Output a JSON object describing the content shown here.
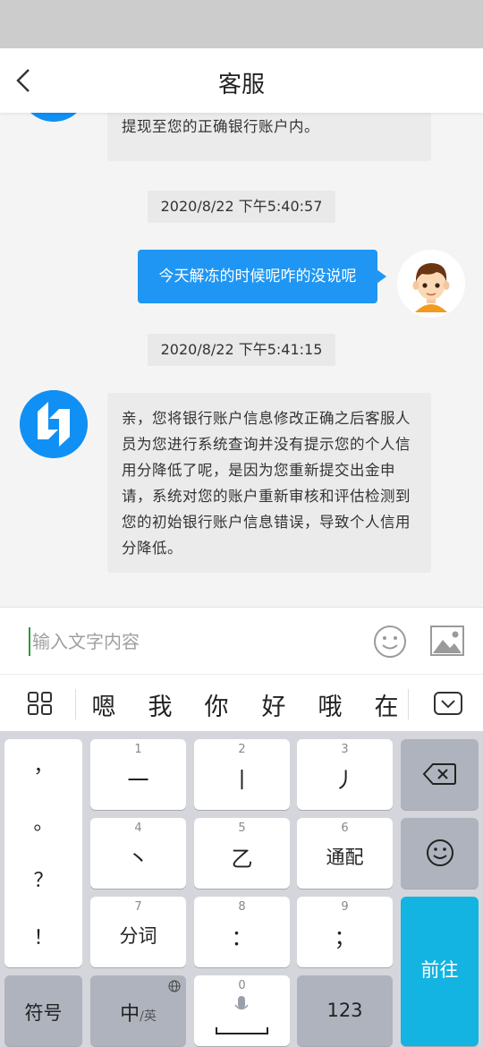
{
  "header": {
    "title": "客服",
    "back_icon": "chevron-left-icon"
  },
  "messages": {
    "agent_1_tail": "提现至您的正确银行账户内。",
    "timestamp_1": "2020/8/22 下午5:40:57",
    "user_1": "今天解冻的时候呢咋的没说呢",
    "timestamp_2": "2020/8/22 下午5:41:15",
    "agent_2": "亲，您将银行账户信息修改正确之后客服人员为您进行系统查询并没有提示您的个人信用分降低了呢，是因为您重新提交出金申请，系统对您的账户重新审核和评估检测到您的初始银行账户信息错误，导致个人信用分降低。"
  },
  "input": {
    "placeholder": "输入文字内容",
    "emoji_icon": "smiley-icon",
    "image_icon": "image-icon"
  },
  "candidates": {
    "menu_icon": "grid-icon",
    "items": [
      "嗯",
      "我",
      "你",
      "好",
      "哦",
      "在"
    ],
    "hide_icon": "keyboard-hide-icon"
  },
  "keyboard": {
    "punct": [
      "，",
      "。",
      "？",
      "！"
    ],
    "keys": [
      {
        "num": "1",
        "label": "一"
      },
      {
        "num": "2",
        "label": "丨"
      },
      {
        "num": "3",
        "label": "丿"
      },
      {
        "num": "4",
        "label": "丶"
      },
      {
        "num": "5",
        "label": "乙"
      },
      {
        "num": "6",
        "label": "通配"
      },
      {
        "num": "7",
        "label": "分词"
      },
      {
        "num": "8",
        "label": "："
      },
      {
        "num": "9",
        "label": "；"
      }
    ],
    "symbols_label": "符号",
    "lang_label_main": "中",
    "lang_label_sub": "/英",
    "space_num": "0",
    "numbers_label": "123",
    "send_label": "前往",
    "backspace_icon": "backspace-icon",
    "emoji_icon": "smiley-icon",
    "mic_icon": "microphone-icon",
    "globe_icon": "globe-icon"
  }
}
